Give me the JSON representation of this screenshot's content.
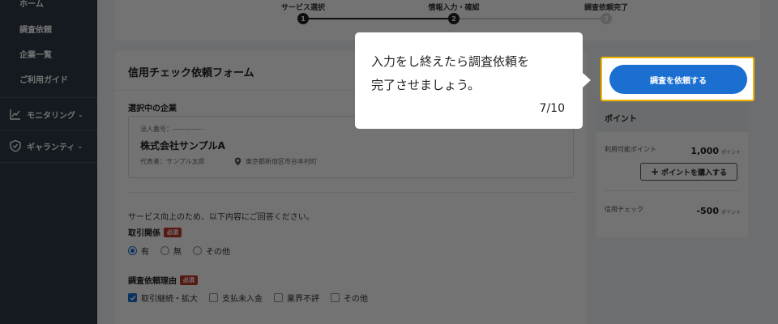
{
  "sidebar": {
    "items": [
      {
        "label": "ホーム"
      },
      {
        "label": "調査依頼"
      },
      {
        "label": "企業一覧"
      },
      {
        "label": "ご利用ガイド"
      }
    ],
    "groups": [
      {
        "label": "モニタリング",
        "icon": "chart-line-icon"
      },
      {
        "label": "ギャランティ",
        "icon": "shield-check-icon"
      }
    ]
  },
  "stepper": {
    "steps": [
      {
        "label": "サービス選択",
        "number": "1",
        "state": "done"
      },
      {
        "label": "情報入力・確認",
        "number": "2",
        "state": "current"
      },
      {
        "label": "調査依頼完了",
        "number": "3",
        "state": "pending"
      }
    ]
  },
  "form": {
    "title": "信用チェック依頼フォーム",
    "selected_company_label": "選択中の企業",
    "company": {
      "corp_number": "法人番号：-------------",
      "name": "株式会社サンプルA",
      "representative": "代表者：サンプル太郎",
      "address": "東京都新宿区市谷本村町"
    },
    "survey_note": "サービス向上のため、以下内容にご回答ください。",
    "relation": {
      "label": "取引関係",
      "required": "必須",
      "options": [
        {
          "label": "有",
          "checked": true
        },
        {
          "label": "無",
          "checked": false
        },
        {
          "label": "その他",
          "checked": false
        }
      ]
    },
    "reason": {
      "label": "調査依頼理由",
      "required": "必須",
      "options": [
        {
          "label": "取引継続・拡大",
          "checked": true
        },
        {
          "label": "支払未入金",
          "checked": false
        },
        {
          "label": "業界不評",
          "checked": false
        },
        {
          "label": "その他",
          "checked": false
        }
      ]
    }
  },
  "cta": {
    "label": "調査を依頼する"
  },
  "points": {
    "title": "ポイント",
    "available_label": "利用可能ポイント",
    "available_value": "1,000",
    "unit": "ポイント",
    "buy_label": "ポイントを購入する",
    "credit_check_label": "信用チェック",
    "credit_check_value": "-500"
  },
  "tooltip": {
    "line1": "入力をし終えたら調査依頼を",
    "line2": "完了させましょう。",
    "counter": "7/10"
  },
  "colors": {
    "accent": "#1a6fd1",
    "highlight": "#f0b400",
    "sidebar": "#2e3a47",
    "required": "#c0392b"
  }
}
